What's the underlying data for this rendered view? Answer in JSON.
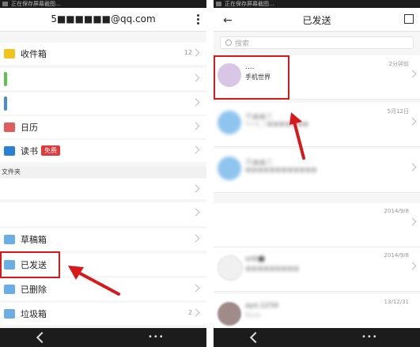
{
  "left": {
    "statusbar": "正在保存屏幕截图...",
    "account": "5■■■■■■@qq.com",
    "folders_top": [
      {
        "label": "收件箱",
        "count": "12",
        "icon": "inbox-icon",
        "color": "#f2c31a"
      },
      {
        "label": "",
        "count": "",
        "icon": "green-bar-icon",
        "color": "#5bc44a"
      },
      {
        "label": "",
        "count": "",
        "icon": "blue-bar-icon",
        "color": "#4a8bd8"
      },
      {
        "label": "日历",
        "count": "",
        "icon": "calendar-icon",
        "color": "#e25a5a"
      },
      {
        "label": "读书",
        "badge": "免费",
        "icon": "book-icon",
        "color": "#2a7fd6"
      }
    ],
    "section": "文件夹",
    "folders_bottom": [
      {
        "label": "草稿箱",
        "count": ""
      },
      {
        "label": "已发送",
        "count": ""
      },
      {
        "label": "已删除",
        "count": ""
      },
      {
        "label": "垃圾箱",
        "count": "2"
      }
    ],
    "nav_dots": "•••"
  },
  "right": {
    "statusbar": "正在保存屏幕截图...",
    "title": "已发送",
    "search_placeholder": "搜索",
    "mails": [
      {
        "line1": "....",
        "line2": "手机世界",
        "date": "2分钟前",
        "blur": false
      },
      {
        "line1": "黄■■文",
        "line2": "tong_1■■■■■■■",
        "date": "5月12日",
        "blur": true
      },
      {
        "line1": "黄■■文",
        "line2": "■■■■■■■■■■■■",
        "date": "",
        "blur": true
      },
      {
        "line1": "",
        "line2": "",
        "date": "2014/9/8",
        "blur": true
      },
      {
        "line1": "snb■",
        "line2": "■■■■■■■■■",
        "date": "2014/9/8",
        "blur": true
      },
      {
        "line1": "ayo.1234",
        "line2": "Book",
        "date": "13/12/31",
        "blur": true
      }
    ],
    "nav_dots": "•••"
  },
  "colors": {
    "highlight": "#d9181b",
    "folder": "#6aaee8"
  }
}
